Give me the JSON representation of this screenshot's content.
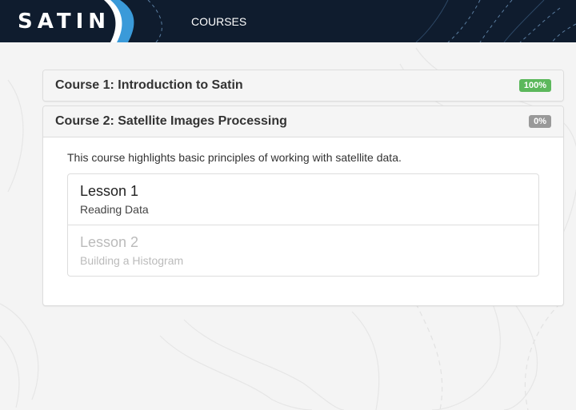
{
  "navbar": {
    "logo_text": "SATIN",
    "courses_link": "COURSES"
  },
  "courses": [
    {
      "title": "Course 1: Introduction to Satin",
      "progress": "100%",
      "progress_color": "#5cb85c",
      "expanded": false
    },
    {
      "title": "Course 2: Satellite Images Processing",
      "progress": "0%",
      "progress_color": "#999999",
      "expanded": true,
      "description": "This course highlights basic principles of working with satellite data.",
      "lessons": [
        {
          "title": "Lesson 1",
          "subtitle": "Reading Data",
          "enabled": true
        },
        {
          "title": "Lesson 2",
          "subtitle": "Building a Histogram",
          "enabled": false
        }
      ]
    }
  ],
  "colors": {
    "navbar_bg": "#0f1c2e",
    "logo_accent": "#3a9ad9",
    "page_bg": "#f4f4f4"
  }
}
